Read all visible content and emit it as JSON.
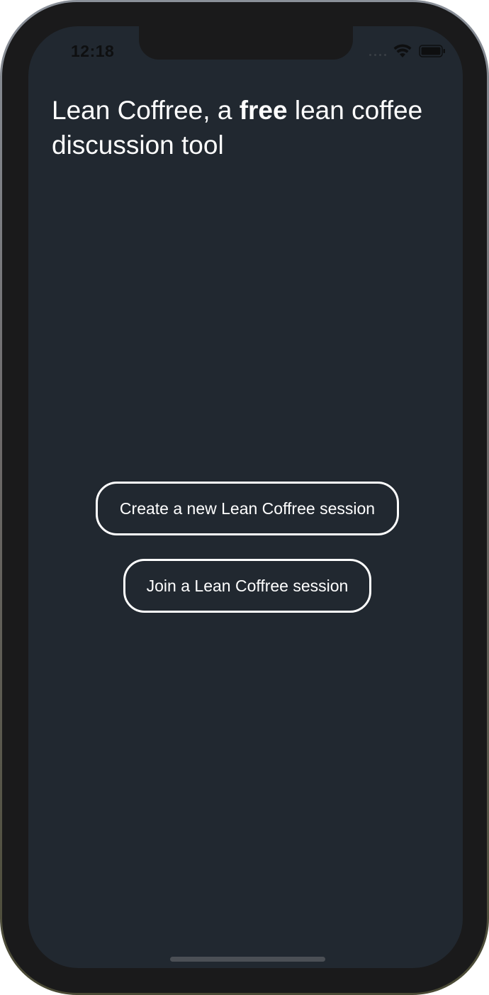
{
  "status_bar": {
    "time": "12:18",
    "icons": [
      "cellular-signal-icon",
      "wifi-icon",
      "battery-icon"
    ]
  },
  "header": {
    "title_before": "Lean Coffree, a ",
    "title_bold": "free",
    "title_after": " lean coffee discussion tool"
  },
  "actions": {
    "create_label": "Create a new Lean Coffree session",
    "join_label": "Join a Lean Coffree session"
  },
  "theme": {
    "background": "#212830",
    "text": "#ffffff",
    "button_border": "#ffffff",
    "device_bezel": "#1a1a1b"
  }
}
